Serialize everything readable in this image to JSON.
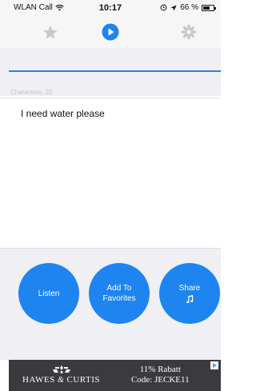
{
  "status_bar": {
    "carrier": "WLAN Call",
    "time": "10:17",
    "battery": "66 %",
    "battery_level": 0.66
  },
  "toolbar": {
    "icons": [
      "star-icon",
      "play-icon",
      "gear-icon"
    ],
    "active_color": "#1e84f0",
    "inactive_color": "#c7c7cc"
  },
  "editor": {
    "char_count": "Characters: 20",
    "text": "I need water please",
    "divider_color": "#2f7ed8"
  },
  "actions": {
    "listen_label": "Listen",
    "favorites_label": "Add To Favorites",
    "share_label": "Share",
    "button_color": "#1e84f0"
  },
  "ad": {
    "brand_part1": "HAWES",
    "brand_connector": "&",
    "brand_part2": "CURTIS",
    "promo_line1": "11% Rabatt",
    "promo_line2": "Code: JECKE11"
  }
}
